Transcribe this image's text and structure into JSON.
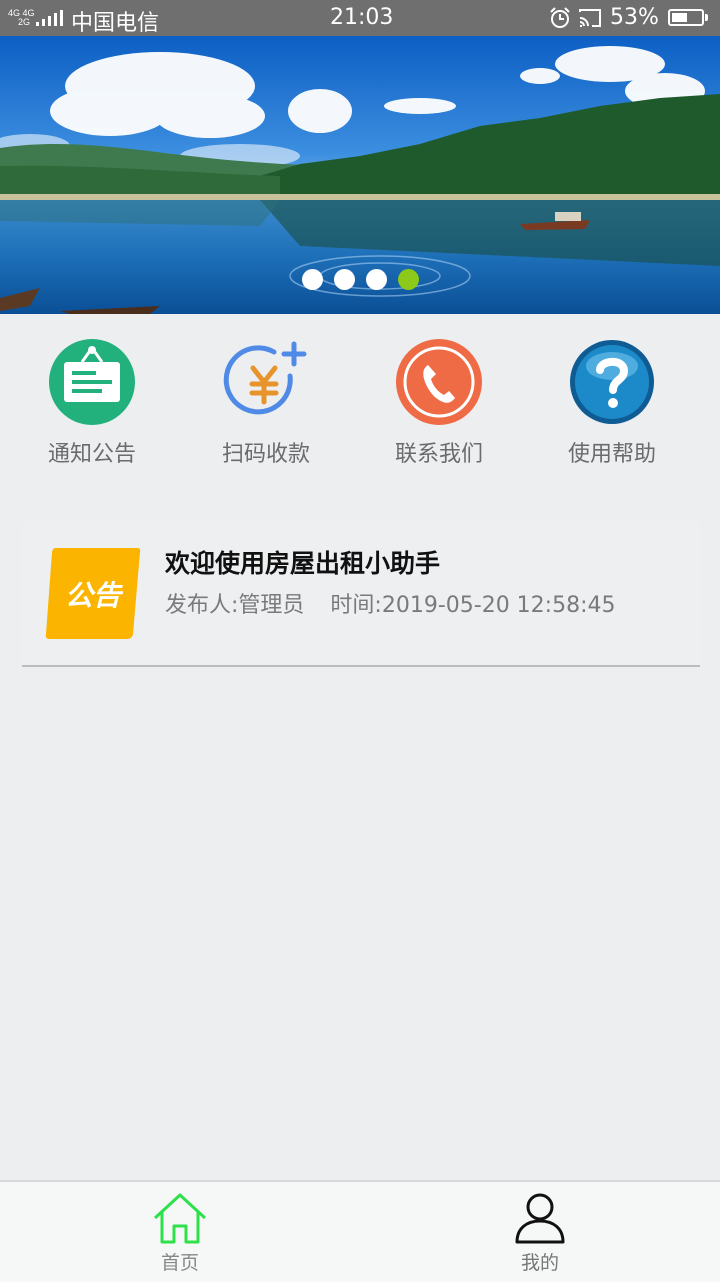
{
  "status_bar": {
    "network_top": "4G 4G",
    "network_bottom": "2G",
    "carrier": "中国电信",
    "time": "21:03",
    "battery_percent": 53,
    "battery_text": "53%",
    "icons": [
      "signal-icon",
      "alarm-icon",
      "cast-icon",
      "battery-icon"
    ]
  },
  "banner": {
    "slides_total": 4,
    "active_index": 3,
    "active_dot_color": "#8cc919",
    "inactive_dot_color": "#ffffff"
  },
  "menu": {
    "items": [
      {
        "label": "通知公告",
        "icon": "notice-board-icon",
        "color": "#22b07d"
      },
      {
        "label": "扫码收款",
        "icon": "scan-payment-icon",
        "color": "#e8942d"
      },
      {
        "label": "联系我们",
        "icon": "phone-icon",
        "color": "#ee6b46"
      },
      {
        "label": "使用帮助",
        "icon": "help-icon",
        "color": "#1678b4"
      }
    ]
  },
  "notice": {
    "badge_text": "公告",
    "badge_color": "#fbb500",
    "title": "欢迎使用房屋出租小助手",
    "publisher": "发布人:管理员",
    "time": "时间:2019-05-20 12:58:45"
  },
  "bottom_nav": {
    "items": [
      {
        "label": "首页",
        "icon": "home-icon",
        "active": true,
        "color": "#2ee04a"
      },
      {
        "label": "我的",
        "icon": "user-icon",
        "active": false,
        "color": "#111111"
      }
    ]
  }
}
